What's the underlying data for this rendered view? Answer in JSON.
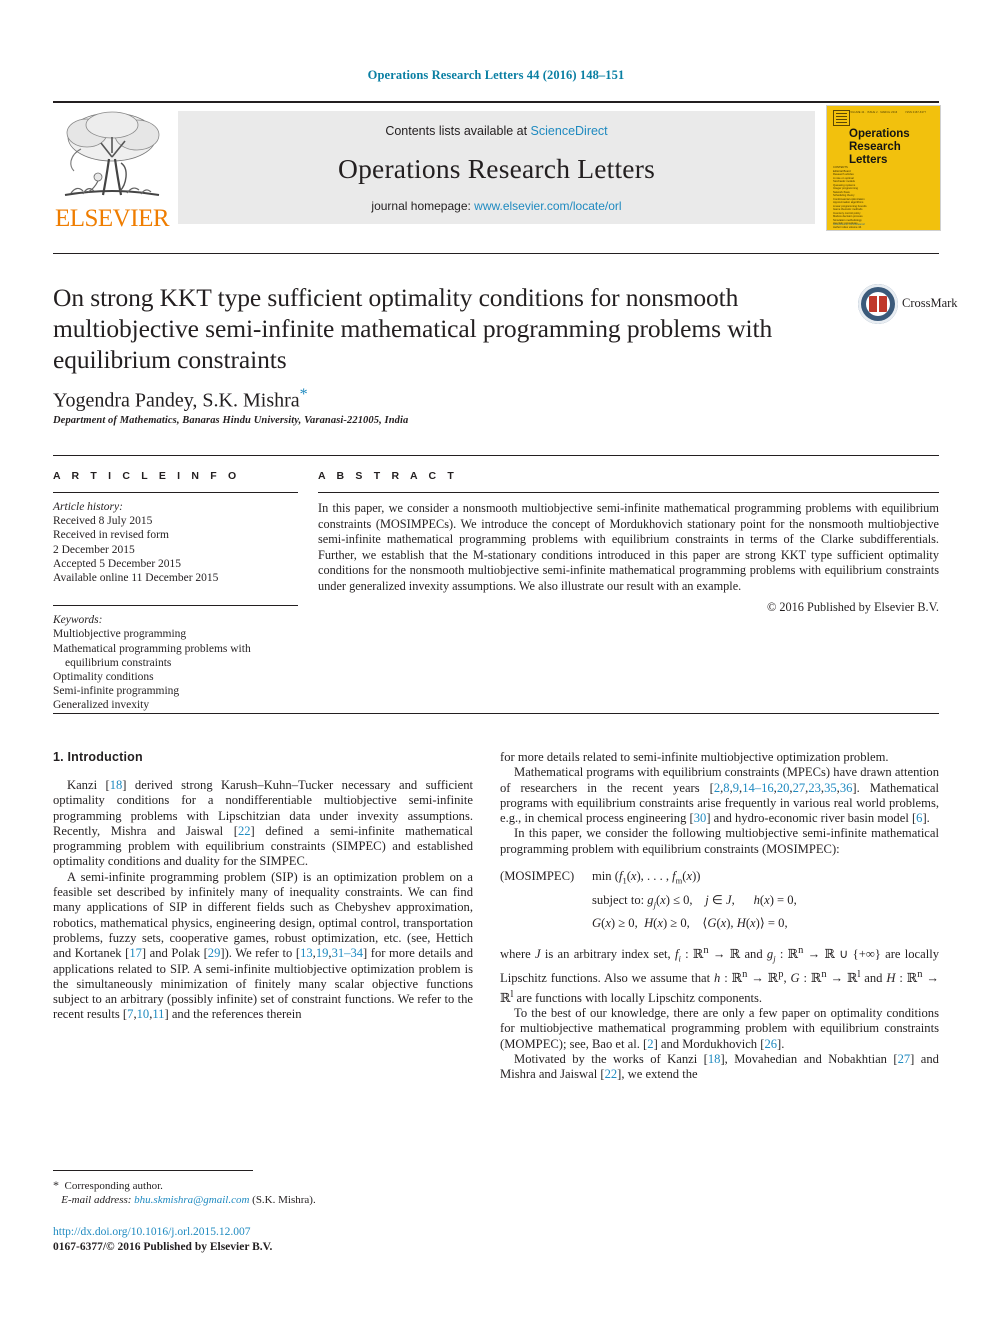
{
  "running_head": "Operations Research Letters 44 (2016) 148–151",
  "masthead": {
    "contents_prefix": "Contents lists available at ",
    "sciencedirect": "ScienceDirect",
    "journal_name": "Operations Research Letters",
    "homepage_prefix": "journal homepage: ",
    "homepage_url": "www.elsevier.com/locate/orl",
    "publisher_wordmark": "ELSEVIER",
    "publisher_logo_icon": "elsevier-tree-logo",
    "accent_link_color": "#1f8ac0",
    "wordmark_color": "#ef7d00"
  },
  "cover": {
    "title_line1": "Operations",
    "title_line2": "Research",
    "title_line3": "Letters",
    "background_color": "#f2c10d"
  },
  "title": "On strong KKT type sufficient optimality conditions for nonsmooth multiobjective semi-infinite mathematical programming problems with equilibrium constraints",
  "crossmark": {
    "label": "CrossMark",
    "icon": "crossmark-badge-icon"
  },
  "authors": "Yogendra Pandey, S.K. Mishra",
  "author_star": "*",
  "affiliation": "Department of Mathematics, Banaras Hindu University, Varanasi-221005, India",
  "article_info": {
    "heading": "A R T I C L E   I N F O",
    "history_label": "Article history:",
    "history": [
      "Received 8 July 2015",
      "Received in revised form",
      "2 December 2015",
      "Accepted 5 December 2015",
      "Available online 11 December 2015"
    ],
    "keywords_label": "Keywords:",
    "keywords": [
      "Multiobjective programming",
      "Mathematical programming problems with",
      "equilibrium constraints",
      "Optimality conditions",
      "Semi-infinite programming",
      "Generalized invexity"
    ]
  },
  "abstract": {
    "heading": "A B S T R A C T",
    "text": "In this paper, we consider a nonsmooth multiobjective semi-infinite mathematical programming problems with equilibrium constraints (MOSIMPECs). We introduce the concept of Mordukhovich stationary point for the nonsmooth multiobjective semi-infinite mathematical programming problems with equilibrium constraints in terms of the Clarke subdifferentials. Further, we establish that the M-stationary conditions introduced in this paper are strong KKT type sufficient optimality conditions for the nonsmooth multiobjective semi-infinite mathematical programming problems with equilibrium constraints under generalized invexity assumptions. We also illustrate our result with an example.",
    "copyright": "© 2016 Published by Elsevier B.V."
  },
  "section1": {
    "heading": "1.  Introduction"
  },
  "footnote": {
    "star": "*",
    "corresponding": "Corresponding author.",
    "email_label": "E-mail address:",
    "email": "bhu.skmishra@gmail.com",
    "email_owner": "(S.K. Mishra)."
  },
  "footer": {
    "doi": "http://dx.doi.org/10.1016/j.orl.2015.12.007",
    "issn_line": "0167-6377/© 2016 Published by Elsevier B.V."
  }
}
